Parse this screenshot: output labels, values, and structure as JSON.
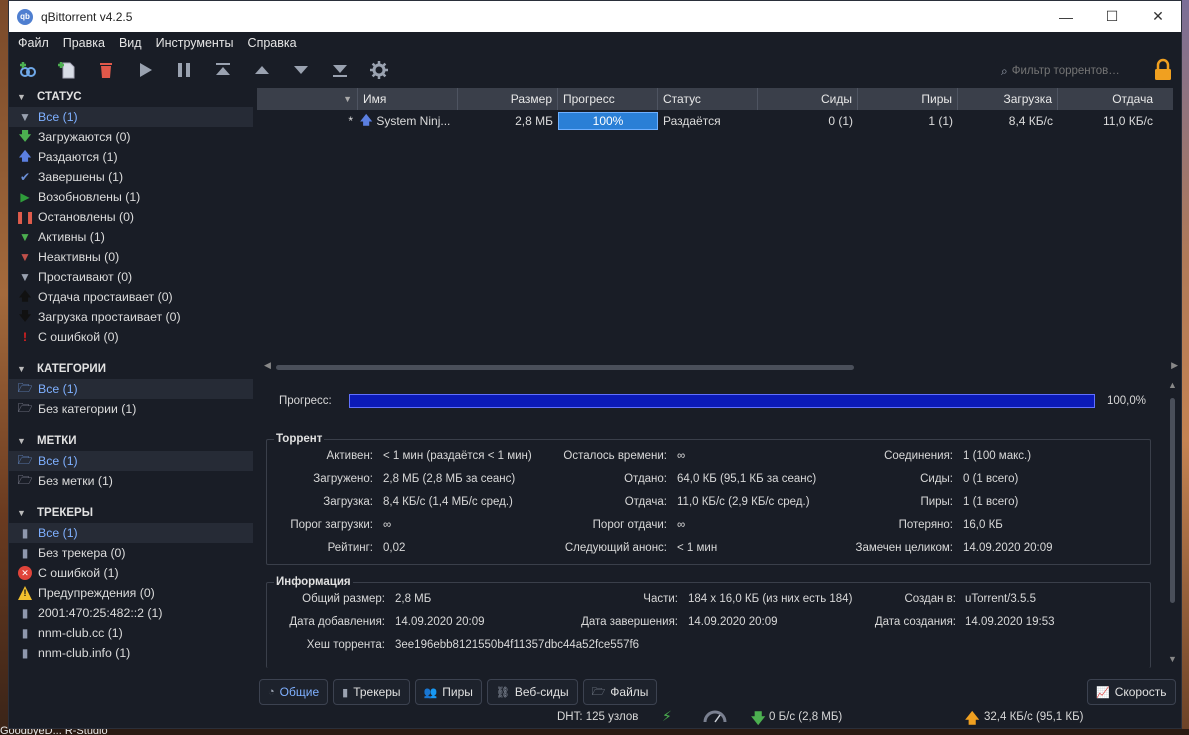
{
  "window": {
    "title": "qBittorrent v4.2.5",
    "icon_text": "qb"
  },
  "menu": [
    "Файл",
    "Правка",
    "Вид",
    "Инструменты",
    "Справка"
  ],
  "search": {
    "placeholder": "Фильтр торрентов…"
  },
  "sidebar": {
    "status": {
      "title": "СТАТУС",
      "items": [
        {
          "label": "Все (1)",
          "icon": "filter-icon",
          "color": "#9aa2b0"
        },
        {
          "label": "Загружаются (0)",
          "icon": "download-arrow-icon",
          "color": "#4caf50"
        },
        {
          "label": "Раздаются (1)",
          "icon": "upload-arrow-icon",
          "color": "#5b7fe0"
        },
        {
          "label": "Завершены (1)",
          "icon": "checkmark-icon",
          "color": "#6b8fd6"
        },
        {
          "label": "Возобновлены (1)",
          "icon": "play-icon",
          "color": "#2e9c3a"
        },
        {
          "label": "Остановлены (0)",
          "icon": "pause-icon",
          "color": "#e05c4c"
        },
        {
          "label": "Активны (1)",
          "icon": "filter-active-icon",
          "color": "#4caf50"
        },
        {
          "label": "Неактивны (0)",
          "icon": "filter-inactive-icon",
          "color": "#c0504a"
        },
        {
          "label": "Простаивают (0)",
          "icon": "filter-stalled-icon",
          "color": "#9aa2b0"
        },
        {
          "label": "Отдача простаивает (0)",
          "icon": "stalled-upload-icon",
          "color": "#111111"
        },
        {
          "label": "Загрузка простаивает (0)",
          "icon": "stalled-download-icon",
          "color": "#111111"
        },
        {
          "label": "С ошибкой (0)",
          "icon": "error-exclamation-icon",
          "color": "#e02020"
        }
      ]
    },
    "categories": {
      "title": "КАТЕГОРИИ",
      "items": [
        "Все (1)",
        "Без категории (1)"
      ]
    },
    "tags": {
      "title": "МЕТКИ",
      "items": [
        "Все (1)",
        "Без метки (1)"
      ]
    },
    "trackers": {
      "title": "ТРЕКЕРЫ",
      "items": [
        {
          "label": "Все (1)",
          "icon": "tracker-icon"
        },
        {
          "label": "Без трекера (0)",
          "icon": "tracker-icon"
        },
        {
          "label": "С ошибкой (1)",
          "icon": "error-circle-icon"
        },
        {
          "label": "Предупреждения (0)",
          "icon": "warning-icon"
        },
        {
          "label": "2001:470:25:482::2 (1)",
          "icon": "tracker-icon"
        },
        {
          "label": "nnm-club.cc (1)",
          "icon": "tracker-icon"
        },
        {
          "label": "nnm-club.info (1)",
          "icon": "tracker-icon"
        }
      ]
    }
  },
  "table": {
    "headers": [
      "Имя",
      "Размер",
      "Прогресс",
      "Статус",
      "Сиды",
      "Пиры",
      "Загрузка",
      "Отдача"
    ],
    "rows": [
      {
        "star": "*",
        "name": "System Ninj...",
        "size": "2,8 МБ",
        "progress": "100%",
        "progress_value": 1.0,
        "status": "Раздаётся",
        "seeds": "0 (1)",
        "peers": "1 (1)",
        "down": "8,4 КБ/с",
        "up": "11,0 КБ/с"
      }
    ]
  },
  "properties": {
    "progress_label": "Прогресс:",
    "progress_value": "100,0%",
    "torrent_group": "Торрент",
    "torrent": {
      "c1": [
        [
          "Активен:",
          "< 1 мин (раздаётся < 1 мин)"
        ],
        [
          "Загружено:",
          "2,8 МБ (2,8 МБ за сеанс)"
        ],
        [
          "Загрузка:",
          "8,4 КБ/с (1,4 МБ/с сред.)"
        ],
        [
          "Порог загрузки:",
          "∞"
        ],
        [
          "Рейтинг:",
          "0,02"
        ]
      ],
      "c2": [
        [
          "Осталось времени:",
          "∞"
        ],
        [
          "Отдано:",
          "64,0 КБ (95,1 КБ за сеанс)"
        ],
        [
          "Отдача:",
          "11,0 КБ/с (2,9 КБ/с сред.)"
        ],
        [
          "Порог отдачи:",
          "∞"
        ],
        [
          "Следующий анонс:",
          "< 1 мин"
        ]
      ],
      "c3": [
        [
          "Соединения:",
          "1 (100 макс.)"
        ],
        [
          "Сиды:",
          "0 (1 всего)"
        ],
        [
          "Пиры:",
          "1 (1 всего)"
        ],
        [
          "Потеряно:",
          "16,0 КБ"
        ],
        [
          "Замечен целиком:",
          "14.09.2020 20:09"
        ]
      ]
    },
    "info_group": "Информация",
    "info": {
      "c1": [
        [
          "Общий размер:",
          "2,8 МБ"
        ],
        [
          "Дата добавления:",
          "14.09.2020 20:09"
        ],
        [
          "Хеш торрента:",
          "3ee196ebb8121550b4f11357dbc44a52fce557f6"
        ]
      ],
      "c2": [
        [
          "Части:",
          "184 x 16,0 КБ (из них есть 184)"
        ],
        [
          "Дата завершения:",
          "14.09.2020 20:09"
        ]
      ],
      "c3": [
        [
          "Создан в:",
          "uTorrent/3.5.5"
        ],
        [
          "Дата создания:",
          "14.09.2020 19:53"
        ]
      ]
    }
  },
  "tabs": [
    {
      "label": "Общие",
      "icon": "general-icon"
    },
    {
      "label": "Трекеры",
      "icon": "trackers-icon"
    },
    {
      "label": "Пиры",
      "icon": "peers-icon"
    },
    {
      "label": "Веб-сиды",
      "icon": "webseeds-icon"
    },
    {
      "label": "Файлы",
      "icon": "files-icon"
    }
  ],
  "speed_tab": "Скорость",
  "statusbar": {
    "dht": "DHT: 125 узлов",
    "down": "0 Б/с (2,8 МБ)",
    "up": "32,4 КБ/с (95,1 КБ)"
  },
  "desktop": {
    "taskbar_text": "GoodbyeD... R-Studio"
  },
  "colors": {
    "accent": "#2a7fd6",
    "progress_bar": "#0b1ab8",
    "selected_text": "#7fb0ff"
  }
}
